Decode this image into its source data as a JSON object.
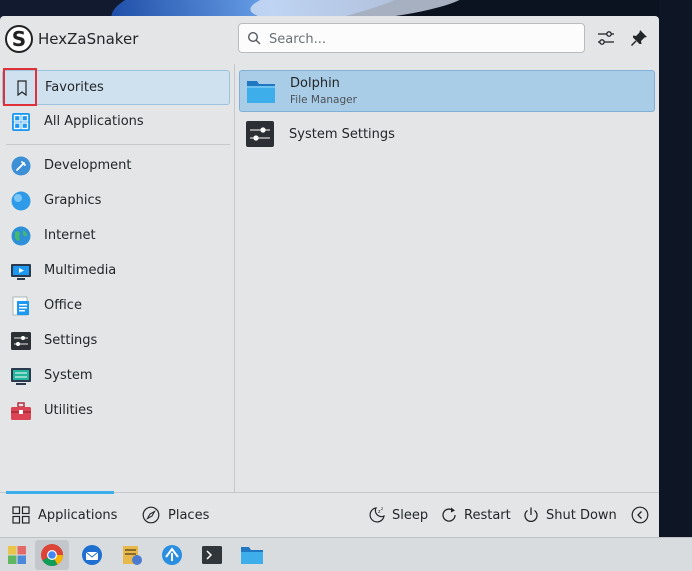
{
  "user": {
    "name": "HexZaSnaker",
    "avatar_letter": "S"
  },
  "search": {
    "placeholder": "Search..."
  },
  "header": {
    "configure_icon": "sliders-icon",
    "pin_icon": "pin-icon"
  },
  "sidebar": {
    "items": [
      {
        "label": "Favorites",
        "icon": "bookmark-icon"
      },
      {
        "label": "All Applications",
        "icon": "grid-icon"
      },
      {
        "label": "Development",
        "icon": "development-icon"
      },
      {
        "label": "Graphics",
        "icon": "graphics-icon"
      },
      {
        "label": "Internet",
        "icon": "globe-icon"
      },
      {
        "label": "Multimedia",
        "icon": "multimedia-icon"
      },
      {
        "label": "Office",
        "icon": "office-icon"
      },
      {
        "label": "Settings",
        "icon": "settings-icon"
      },
      {
        "label": "System",
        "icon": "system-icon"
      },
      {
        "label": "Utilities",
        "icon": "toolbox-icon"
      }
    ]
  },
  "apps": [
    {
      "name": "Dolphin",
      "subtitle": "File Manager",
      "icon": "folder-icon"
    },
    {
      "name": "System Settings",
      "subtitle": "",
      "icon": "system-settings-icon"
    }
  ],
  "footer": {
    "tabs": [
      {
        "label": "Applications",
        "icon": "apps-grid-icon"
      },
      {
        "label": "Places",
        "icon": "compass-icon"
      }
    ],
    "actions": [
      {
        "label": "Sleep",
        "icon": "sleep-icon"
      },
      {
        "label": "Restart",
        "icon": "restart-icon"
      },
      {
        "label": "Shut Down",
        "icon": "power-icon"
      }
    ],
    "more_icon": "chevron-left-icon"
  },
  "taskbar": {
    "items": [
      "launcher-icon",
      "chrome-icon",
      "thunderbird-icon",
      "archive-manager-icon",
      "network-icon",
      "terminal-icon",
      "file-manager-icon"
    ]
  },
  "colors": {
    "accent": "#3daee9",
    "selection": "#a9cde6",
    "highlight_box": "#e0303a"
  }
}
